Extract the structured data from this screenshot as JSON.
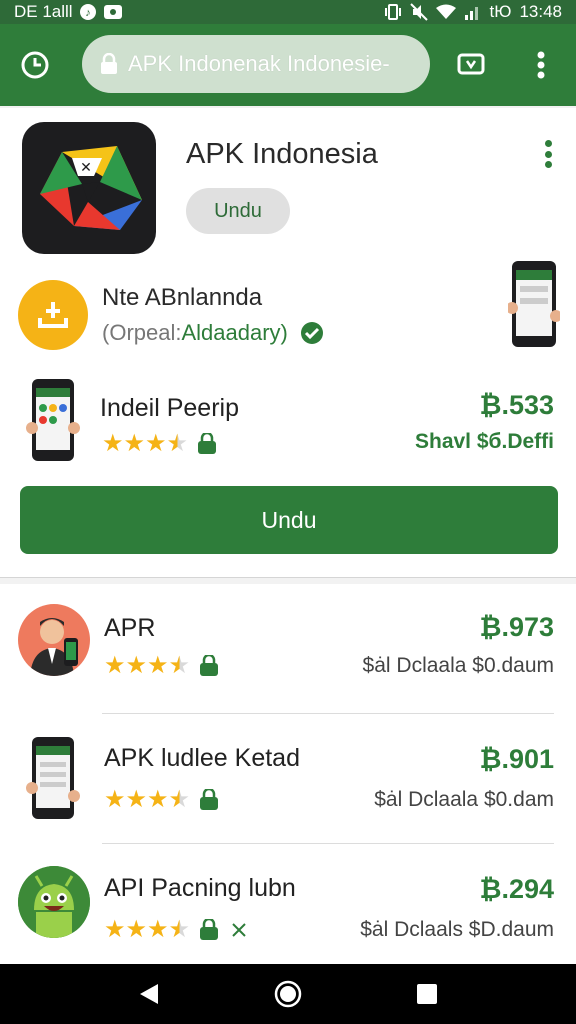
{
  "status_bar": {
    "carrier": "DE 1alll",
    "time": "13:48",
    "misc": "tЮ"
  },
  "browser": {
    "url_text": "APK Indonenak Indonesie-",
    "icons": [
      "history-icon",
      "lock-icon",
      "tab-icon",
      "overflow-menu-icon"
    ]
  },
  "app": {
    "title": "APK Indonesia",
    "pill_label": "Undu"
  },
  "notice": {
    "title": "Nte ABnlannda",
    "subtitle_prefix": "(Orpeal: ",
    "subtitle_highlight": "Aldaadary)"
  },
  "featured": {
    "name": "Indeil Peerip",
    "price": "₿.533",
    "share": "Shavl $б.Deffi",
    "rating": 3.5
  },
  "download_button": "Undu",
  "list": [
    {
      "name": "APR",
      "price": "₿.973",
      "sub": "$ȧl Dclaala $0.daum",
      "rating": 3.5
    },
    {
      "name": "APK ludlee Ketad",
      "price": "₿.901",
      "sub": "$ȧl Dclaala $0.dam",
      "rating": 3.5
    },
    {
      "name": "API Pacning lubn",
      "price": "₿.294",
      "sub": "$ȧl Dclaals $D.daum",
      "rating": 3.5
    }
  ],
  "colors": {
    "primary": "#2f7d3a",
    "status_bar": "#2e6a38",
    "accent_yellow": "#f5b316",
    "text": "#222222"
  }
}
